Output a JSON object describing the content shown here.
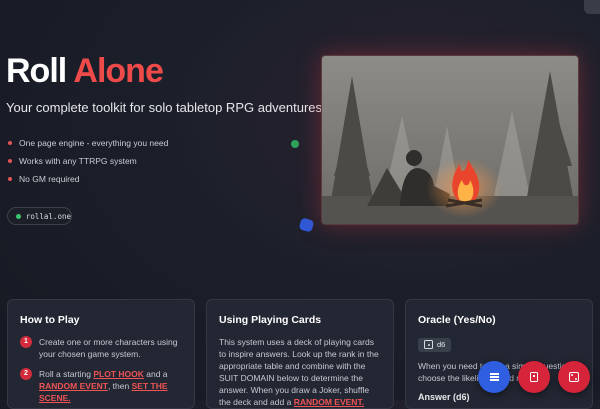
{
  "hero": {
    "title_part1": "Roll",
    "title_part2": "Alone",
    "subtitle": "Your complete toolkit for solo tabletop RPG adventures",
    "features": [
      "One page engine - everything you need",
      "Works with any TTRPG system",
      "No GM required"
    ],
    "url": "rollal.one",
    "accent_color": "#ef4a4a"
  },
  "cards": {
    "how_to_play": {
      "title": "How to Play",
      "steps": [
        {
          "num": "1",
          "text": "Create one or more characters using your chosen game system."
        },
        {
          "num": "2",
          "prefix": "Roll a starting",
          "link1": "PLOT HOOK",
          "mid": "and a",
          "link2": "RANDOM EVENT",
          "suffix": ", then",
          "link3": "SET THE SCENE."
        }
      ]
    },
    "playing_cards": {
      "title": "Using Playing Cards",
      "text": "This system uses a deck of playing cards to inspire answers. Look up the rank in the appropriate table and combine with the SUIT DOMAIN below to determine the answer. When you draw a Joker, shuffle the deck and add a",
      "link": "RANDOM EVENT."
    },
    "oracle": {
      "title": "Oracle (Yes/No)",
      "chip_label": "d6",
      "text": "When you need to ask a simple question, choose the likelihood and roll",
      "answer_label": "Answer (d6)"
    }
  },
  "icons": {
    "menu": "menu-icon",
    "cards": "card-icon",
    "dice": "dice-icon",
    "live": "status-dot-icon"
  }
}
